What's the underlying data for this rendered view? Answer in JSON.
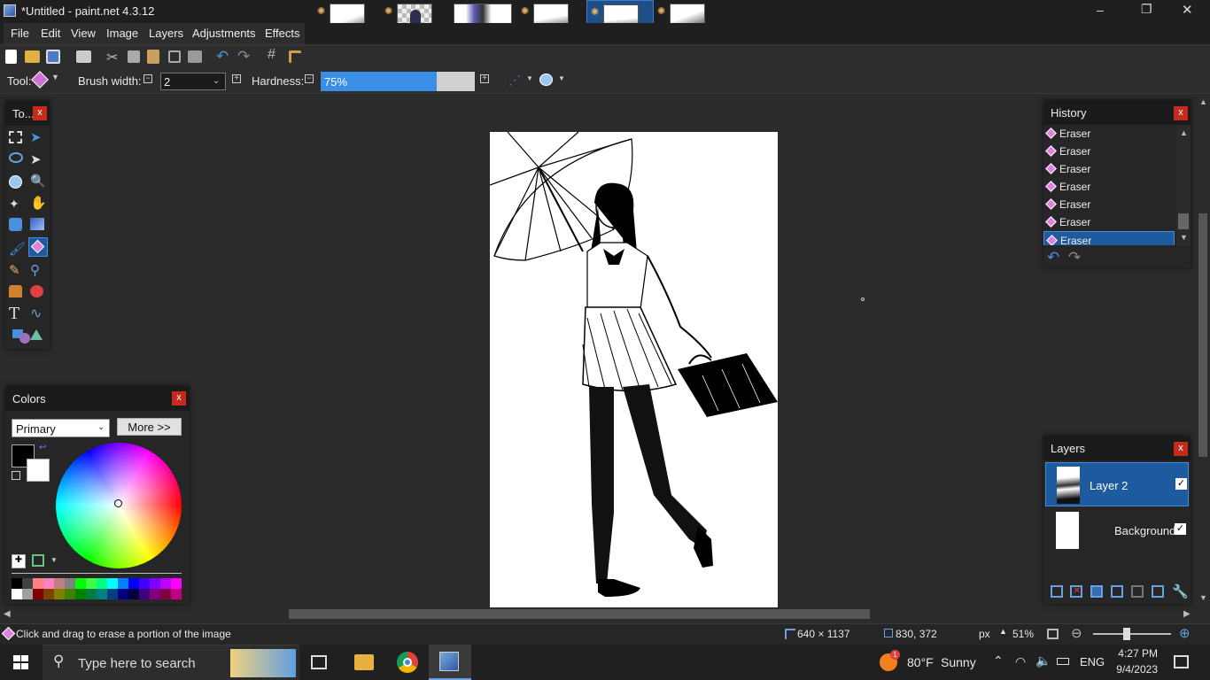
{
  "window": {
    "title": "*Untitled - paint.net 4.3.12",
    "minimize": "–",
    "restore": "❐",
    "close": "✕"
  },
  "menu": [
    "File",
    "Edit",
    "View",
    "Image",
    "Layers",
    "Adjustments",
    "Effects"
  ],
  "toolbar2": {
    "tool_label": "Tool:",
    "brush_width_label": "Brush width:",
    "brush_width_value": "2",
    "hardness_label": "Hardness:",
    "hardness_value": "75%",
    "hardness_fraction": 0.75
  },
  "tools_panel": {
    "title": "To...",
    "close": "x"
  },
  "history_panel": {
    "title": "History",
    "close": "x",
    "items": [
      "Eraser",
      "Eraser",
      "Eraser",
      "Eraser",
      "Eraser",
      "Eraser",
      "Eraser"
    ],
    "selected_index": 6
  },
  "layers_panel": {
    "title": "Layers",
    "close": "x",
    "layers": [
      {
        "name": "Layer 2",
        "visible": true,
        "selected": true
      },
      {
        "name": "Background",
        "visible": true,
        "selected": false
      }
    ]
  },
  "colors_panel": {
    "title": "Colors",
    "close": "x",
    "mode": "Primary",
    "more_button": "More >>",
    "primary_color": "#000000",
    "secondary_color": "#ffffff"
  },
  "palette": [
    "#000000",
    "#404040",
    "#ff8080",
    "#ff80c0",
    "#c08080",
    "#808080",
    "#00ff00",
    "#40ff40",
    "#00ff80",
    "#00ffff",
    "#0080ff",
    "#0000ff",
    "#4000ff",
    "#8000ff",
    "#c000ff",
    "#ff00ff",
    "#ffffff",
    "#a0a0a0",
    "#800000",
    "#804000",
    "#808000",
    "#408000",
    "#008000",
    "#008040",
    "#008080",
    "#004080",
    "#000080",
    "#000040",
    "#400080",
    "#800080",
    "#800040",
    "#c00080"
  ],
  "status": {
    "hint": "Click and drag to erase a portion of the image",
    "image_size": "640 × 1137",
    "cursor_pos": "830, 372",
    "units": "px",
    "zoom": "51%"
  },
  "taskbar": {
    "search_placeholder": "Type here to search",
    "weather_temp": "80°F",
    "weather_desc": "Sunny",
    "weather_badge": "1",
    "language": "ENG",
    "time": "4:27 PM",
    "date": "9/4/2023"
  },
  "colors": {
    "accent": "#0078d7",
    "selected_row": "#1e5a9e",
    "close_red": "#c42b1c"
  }
}
